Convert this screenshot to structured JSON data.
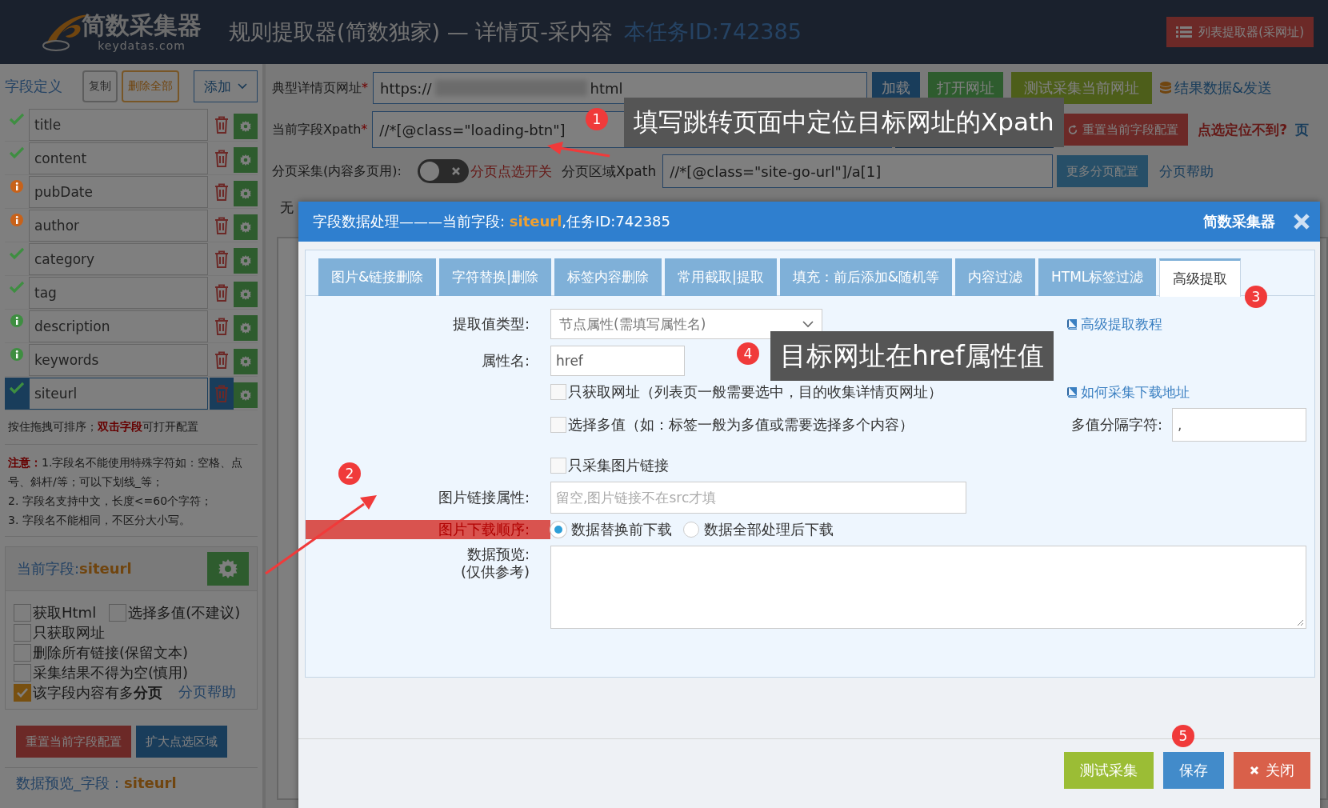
{
  "header": {
    "logo_text": "简数采集器",
    "logo_subtext": "keydatas.com",
    "title": "规则提取器(简数独家) — 详情页-采内容",
    "task_id": "本任务ID:742385",
    "list_button": "列表提取器(采网址)"
  },
  "fields_panel": {
    "title": "字段定义",
    "copy_button": "复制",
    "delete_all_button": "删除全部",
    "add_button": "添加",
    "fields": [
      {
        "name": "title",
        "kind": "check",
        "color": "#3e8e41",
        "selected": false
      },
      {
        "name": "content",
        "kind": "check",
        "color": "#3e8e41",
        "selected": false
      },
      {
        "name": "pubDate",
        "kind": "info",
        "color": "#c8621a",
        "selected": false
      },
      {
        "name": "author",
        "kind": "info",
        "color": "#c8621a",
        "selected": false
      },
      {
        "name": "category",
        "kind": "check",
        "color": "#3e8e41",
        "selected": false
      },
      {
        "name": "tag",
        "kind": "check",
        "color": "#3e8e41",
        "selected": false
      },
      {
        "name": "description",
        "kind": "info",
        "color": "#3e8e41",
        "selected": false
      },
      {
        "name": "keywords",
        "kind": "info",
        "color": "#3e8e41",
        "selected": false
      },
      {
        "name": "siteurl",
        "kind": "check",
        "color": "#3e8e41",
        "selected": true
      }
    ],
    "hint": "按住拖拽可排序；**双击字段**可打开配置",
    "notes": [
      "**注意：**1.字段名不能使用特殊字符如：空格、点号、斜杆/等；可以下划线_等；",
      "2. 字段名支持中文，长度<=60个字符；",
      "3. 字段名不能相同，不区分大小写。"
    ],
    "current_field": {
      "label": "当前字段:",
      "name": "siteurl"
    },
    "options": [
      {
        "label": "获取Html",
        "checked": false
      },
      {
        "label": "选择多值(不建议)",
        "checked": false
      },
      {
        "label": "只获取网址",
        "checked": false
      },
      {
        "label": "删除所有链接(保留文本)",
        "checked": false
      },
      {
        "label": "采集结果不得为空(慎用)",
        "checked": false
      },
      {
        "label": "该字段内容有多**分页**",
        "checked": true
      }
    ],
    "pagination_help": "分页帮助",
    "reset_button": "重置当前字段配置",
    "expand_button": "扩大点选区域",
    "preview_title": {
      "label": "数据预览_字段：",
      "name": "siteurl"
    }
  },
  "main_form": {
    "detail_url": {
      "label": "典型详情页网址",
      "required_mark": "*",
      "value_start": "https://",
      "value_end": "html"
    },
    "load_button": "加载",
    "open_button": "打开网址",
    "test_button": "测试采集当前网址",
    "results_link": "结果数据&发送",
    "xpath": {
      "label": "当前字段Xpath",
      "required_mark": "*",
      "value": "//*[@class=\"loading-btn\"]"
    },
    "reset_button": "重置当前字段配置",
    "locate_link": "点选定位不到?",
    "edge_text": "页",
    "pagination": {
      "label": "分页采集(内容多页用):",
      "on": false,
      "switch_label": "分页点选开关",
      "area_label": "分页区域Xpath",
      "value": "//*[@class=\"site-go-url\"]/a[1]",
      "more_button": "更多分页配置",
      "help_link": "分页帮助"
    },
    "behind_text": "无"
  },
  "modal": {
    "title": "字段数据处理———当前字段: **siteurl**,任务ID:742385",
    "brand": "简数采集器",
    "tabs": [
      {
        "label": "图片&链接删除",
        "selected": false
      },
      {
        "label": "字符替换|删除",
        "selected": false
      },
      {
        "label": "标签内容删除",
        "selected": false
      },
      {
        "label": "常用截取|提取",
        "selected": false
      },
      {
        "label": "填充：前后添加&随机等",
        "selected": false
      },
      {
        "label": "内容过滤",
        "selected": false
      },
      {
        "label": "HTML标签过滤",
        "selected": false
      },
      {
        "label": "高级提取",
        "selected": true
      }
    ],
    "extract_type": {
      "label": "提取值类型:",
      "value": "节点属性(需填写属性名)"
    },
    "attr_name": {
      "label": "属性名:",
      "value": "href"
    },
    "tutorial_link": "高级提取教程",
    "download_link": "如何采集下载地址",
    "checkboxes": [
      {
        "label": "只获取网址（列表页一般需要选中，目的收集详情页网址）",
        "checked": false
      },
      {
        "label": "选择多值（如：标签一般为多值或需要选择多个内容）",
        "checked": false
      },
      {
        "label": "只采集图片链接",
        "checked": false
      }
    ],
    "separator": {
      "label": "多值分隔字符:",
      "value": ","
    },
    "image_attr": {
      "label": "图片链接属性:",
      "placeholder": "留空,图片链接不在src才填"
    },
    "download_order": {
      "label": "图片下载顺序:",
      "options": [
        {
          "label": "数据替换前下载",
          "selected": true
        },
        {
          "label": "数据全部处理后下载",
          "selected": false
        }
      ]
    },
    "preview": {
      "label": "数据预览:",
      "sublabel": "(仅供参考)"
    },
    "buttons": [
      {
        "label": "测试采集",
        "kind": "test"
      },
      {
        "label": "保存",
        "kind": "save"
      },
      {
        "label": "关闭",
        "kind": "close"
      }
    ]
  },
  "annotations": {
    "badges": [
      "1",
      "2",
      "3",
      "4",
      "5"
    ],
    "callouts": [
      "填写跳转页面中定位目标网址的Xpath",
      "目标网址在href属性值"
    ]
  }
}
